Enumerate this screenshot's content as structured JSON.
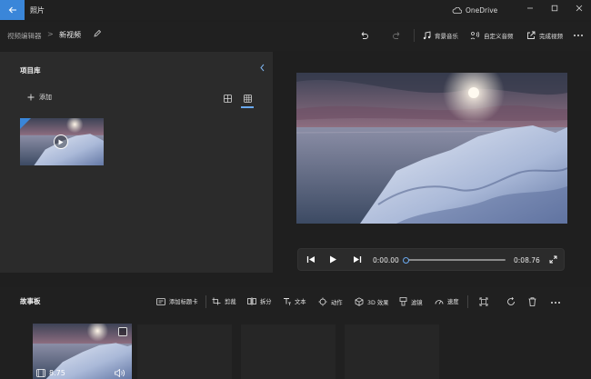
{
  "titlebar": {
    "app_title": "照片",
    "onedrive_label": "OneDrive"
  },
  "breadcrumb": {
    "root": "视频编辑器",
    "separator": ">",
    "current": "新视频"
  },
  "toolbar": {
    "background_music": "背景音乐",
    "custom_audio": "自定义音频",
    "finish_video": "完成视频"
  },
  "library": {
    "title": "项目库",
    "add_label": "添加"
  },
  "playback": {
    "current_time": "0:00.00",
    "total_time": "0:08.76",
    "progress": 0
  },
  "storyboard": {
    "title": "故事板",
    "tools": {
      "add_title_card": "添加标题卡",
      "trim": "剪裁",
      "split": "拆分",
      "text": "文本",
      "motion": "动作",
      "effects_3d": "3D 效果",
      "filters": "滤镜",
      "speed": "速度"
    },
    "clip_duration": "8.75"
  },
  "colors": {
    "accent": "#3a86d9",
    "panel": "#2b2b2b",
    "background": "#1f1f1f"
  },
  "icons": [
    "back-arrow-icon",
    "cloud-icon",
    "minimize-icon",
    "maximize-icon",
    "close-icon",
    "pencil-icon",
    "undo-icon",
    "redo-icon",
    "music-icon",
    "custom-audio-icon",
    "export-icon",
    "more-icon",
    "chevron-left-icon",
    "plus-icon",
    "small-grid-icon",
    "large-grid-icon",
    "play-icon",
    "rewind-icon",
    "forward-icon",
    "fullscreen-icon",
    "title-card-icon",
    "trim-icon",
    "split-icon",
    "text-icon",
    "motion-icon",
    "3d-effects-icon",
    "filter-icon",
    "speed-icon",
    "resize-icon",
    "rotate-icon",
    "trash-icon",
    "film-icon",
    "volume-icon"
  ]
}
